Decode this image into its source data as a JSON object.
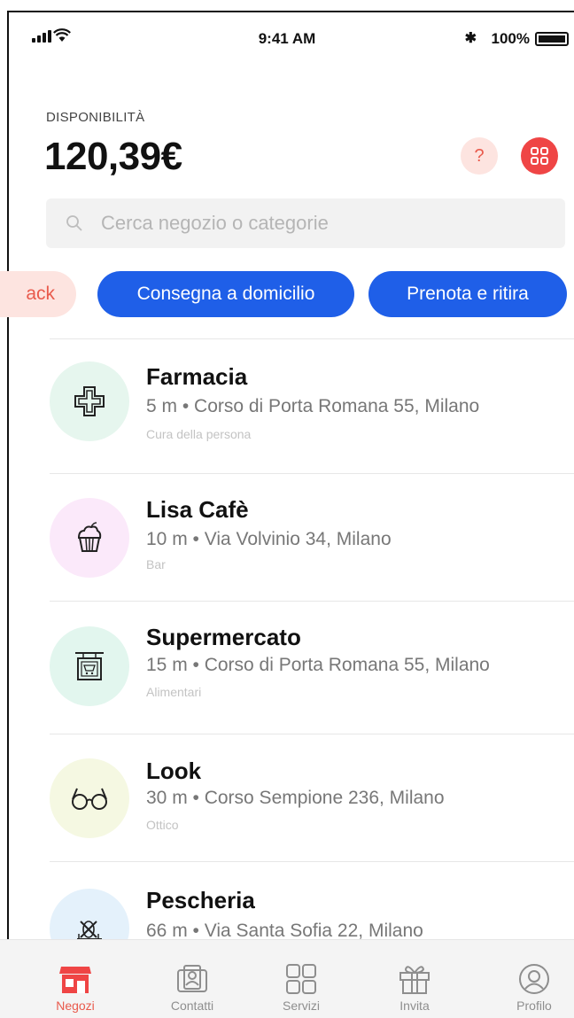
{
  "status_bar": {
    "time": "9:41 AM",
    "battery": "100%"
  },
  "header": {
    "availability_label": "DISPONIBILITÀ",
    "balance": "120,39€",
    "help_label": "?"
  },
  "search": {
    "placeholder": "Cerca negozio o categorie"
  },
  "filters": [
    {
      "label": "ack"
    },
    {
      "label": "Consegna a domicilio"
    },
    {
      "label": "Prenota e ritira"
    }
  ],
  "stores": [
    {
      "name": "Farmacia",
      "distance_address": "5 m • Corso di Porta Romana 55, Milano",
      "category": "Cura della persona",
      "icon": "pharmacy-cross-icon",
      "color": "#e6f6ee"
    },
    {
      "name": "Lisa Cafè",
      "distance_address": "10 m • Via Volvinio 34, Milano",
      "category": "Bar",
      "icon": "cupcake-icon",
      "color": "#fbe9fa"
    },
    {
      "name": "Supermercato",
      "distance_address": "15 m • Corso di Porta Romana 55, Milano",
      "category": "Alimentari",
      "icon": "shop-sign-icon",
      "color": "#e2f6ee"
    },
    {
      "name": "Look",
      "distance_address": "30 m • Corso Sempione 236, Milano",
      "category": "Ottico",
      "icon": "glasses-icon",
      "color": "#f5f8e2"
    },
    {
      "name": "Pescheria",
      "distance_address": "66 m • Via Santa Sofia 22, Milano",
      "category": "",
      "icon": "fish-icon",
      "color": "#e4f1fb"
    }
  ],
  "tabs": [
    {
      "label": "Negozi",
      "icon": "store-icon",
      "active": true
    },
    {
      "label": "Contatti",
      "icon": "contacts-icon",
      "active": false
    },
    {
      "label": "Servizi",
      "icon": "services-grid-icon",
      "active": false
    },
    {
      "label": "Invita",
      "icon": "gift-icon",
      "active": false
    },
    {
      "label": "Profilo",
      "icon": "profile-icon",
      "active": false
    }
  ],
  "colors": {
    "accent_red": "#ef4545",
    "primary_blue": "#1f5fe8",
    "chip_pink": "#fde4e0"
  }
}
